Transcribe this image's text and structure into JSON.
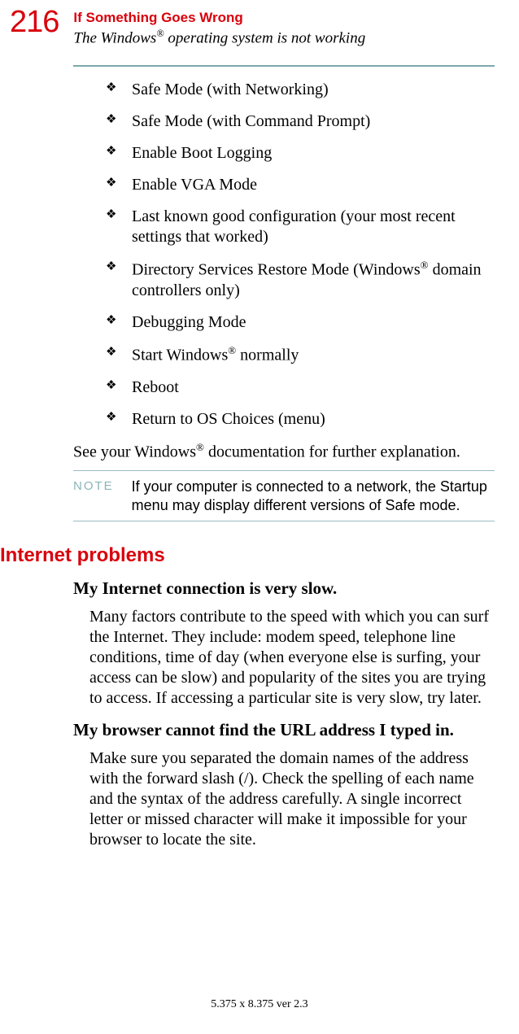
{
  "page_number": "216",
  "chapter_title": "If Something Goes Wrong",
  "section_title": "The Windows® operating system is not working",
  "boot_options": [
    "Safe Mode (with Networking)",
    "Safe Mode (with Command Prompt)",
    "Enable Boot Logging",
    "Enable VGA Mode",
    "Last known good configuration (your most recent settings that worked)",
    "Directory Services Restore Mode (Windows® domain controllers only)",
    "Debugging Mode",
    "Start Windows® normally",
    "Reboot",
    "Return to OS Choices (menu)"
  ],
  "see_more": "See your Windows® documentation for further explanation.",
  "note_label": "NOTE",
  "note_text": "If your computer is connected to a network, the Startup menu may display different versions of Safe mode.",
  "h2_internet": "Internet problems",
  "q1": "My Internet connection is very slow.",
  "a1": "Many factors contribute to the speed with which you can surf the Internet. They include: modem speed, telephone line conditions, time of day (when everyone else is surfing, your access can be slow) and popularity of the sites you are trying to access. If accessing a particular site is very slow, try later.",
  "q2": "My browser cannot find the URL address I typed in.",
  "a2": "Make sure you separated the domain names of the address with the forward slash (/). Check the spelling of each name and the syntax of the address carefully. A single incorrect letter or missed character will make it impossible for your browser to locate the site.",
  "footer": "5.375 x 8.375 ver 2.3",
  "chart_data": null
}
